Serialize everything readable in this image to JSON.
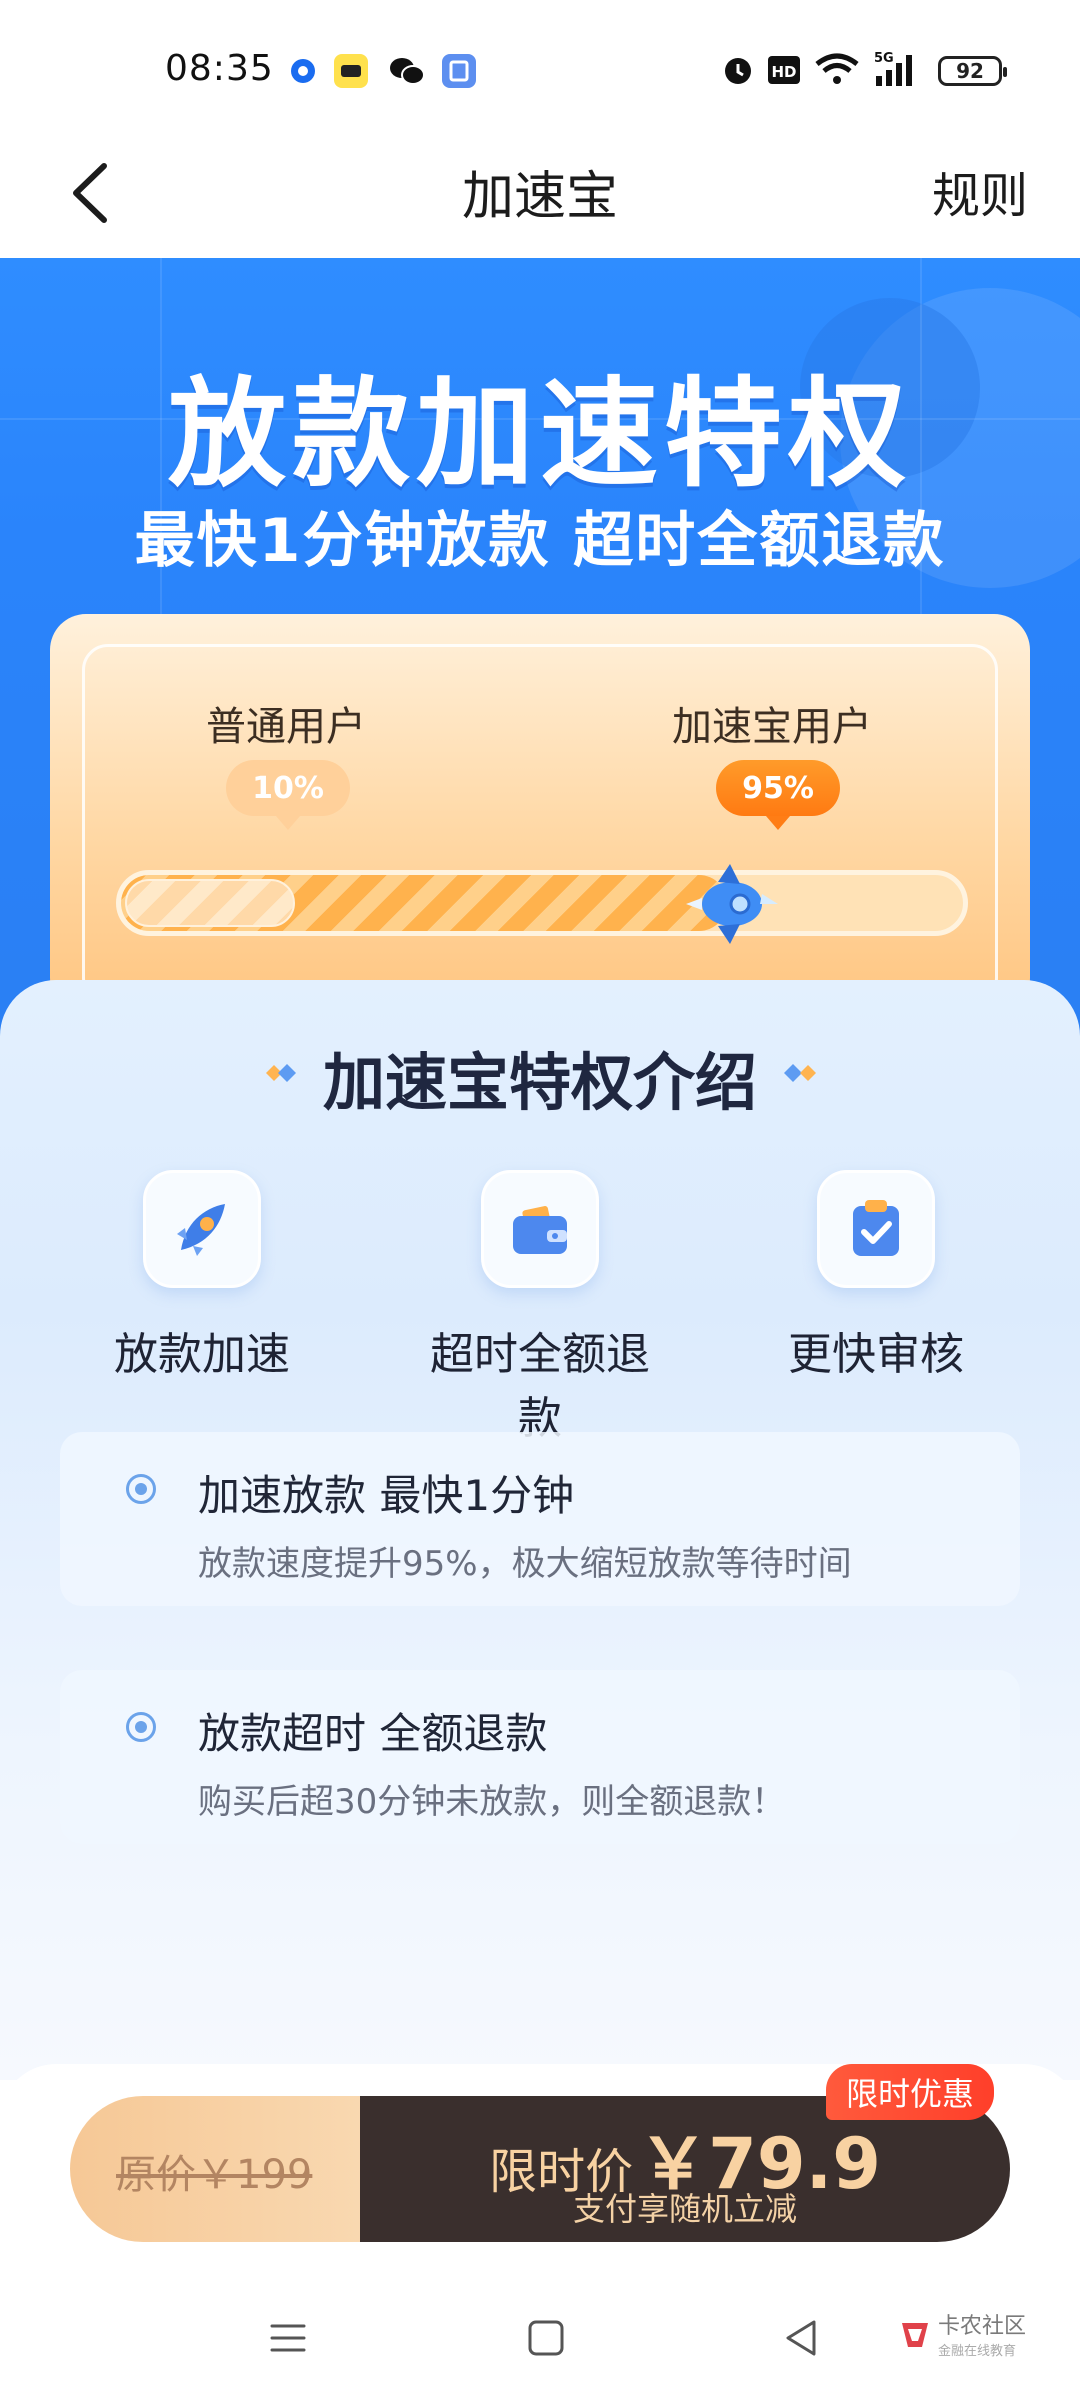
{
  "status_bar": {
    "time": "08:35",
    "battery": "92",
    "network": "5G"
  },
  "nav": {
    "title": "加速宝",
    "rules_label": "规则"
  },
  "hero": {
    "title": "放款加速特权",
    "subtitle": "最快1分钟放款 超时全额退款"
  },
  "compare": {
    "normal_label": "普通用户",
    "normal_percent": "10%",
    "vip_label": "加速宝用户",
    "vip_percent": "95%",
    "progress_fraction": 0.72
  },
  "intro": {
    "title": "加速宝特权介绍",
    "features": [
      {
        "label": "放款加速",
        "icon": "rocket-icon"
      },
      {
        "label": "超时全额退款",
        "icon": "wallet-icon"
      },
      {
        "label": "更快审核",
        "icon": "clipboard-check-icon"
      }
    ],
    "items": [
      {
        "title": "加速放款 最快1分钟",
        "desc": "放款速度提升95%，极大缩短放款等待时间"
      },
      {
        "title": "放款超时 全额退款",
        "desc": "购买后超30分钟未放款，则全额退款！"
      }
    ]
  },
  "purchase": {
    "original_price": "原价￥199",
    "price_label": "限时价",
    "price_value": "￥79.9",
    "sub_text": "支付享随机立减",
    "tag": "限时优惠"
  },
  "watermark": {
    "title": "卡农社区",
    "subtitle": "金融在线教育"
  },
  "colors": {
    "primary_blue": "#2a84fb",
    "accent_orange": "#ff7a12",
    "dark_button": "#3a2f2d",
    "tag_red": "#ff3f2a"
  }
}
